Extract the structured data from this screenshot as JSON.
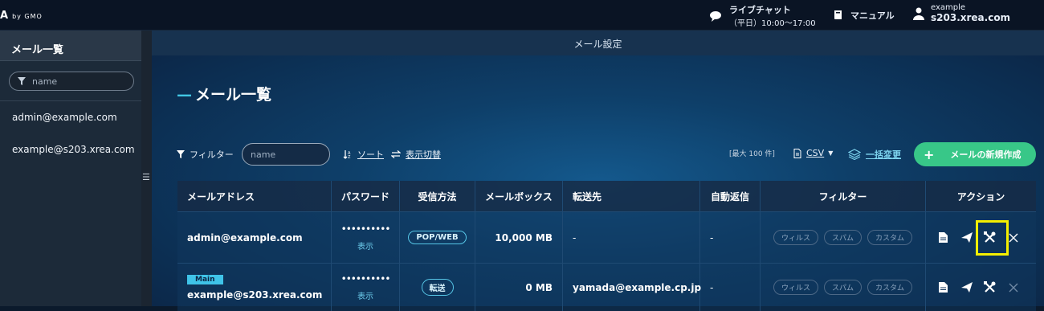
{
  "topbar": {
    "logo": "A",
    "logo_by": "by GMO",
    "chat_title": "ライブチャット",
    "chat_hours": "（平日）10:00〜17:00",
    "manual": "マニュアル",
    "account_user": "example",
    "account_host": "s203.xrea.com"
  },
  "sidebar": {
    "title": "メール一覧",
    "search_placeholder": "name",
    "items": [
      {
        "label": "admin@example.com"
      },
      {
        "label": "example@s203.xrea.com"
      }
    ]
  },
  "main": {
    "header": "メール設定",
    "title": "メール一覧",
    "toolbar": {
      "filter_label": "フィルター",
      "name_placeholder": "name",
      "sort_label": "ソート",
      "view_toggle_label": "表示切替",
      "max_count": "[最大 100 件]",
      "csv_label": "CSV",
      "bulk_change_label": "一括変更",
      "create_label": "メールの新規作成"
    },
    "table": {
      "headers": [
        "メールアドレス",
        "パスワード",
        "受信方法",
        "メールボックス",
        "転送先",
        "自動返信",
        "フィルター",
        "アクション"
      ],
      "rows": [
        {
          "badge": "",
          "address": "admin@example.com",
          "password": "••••••••••",
          "password_show": "表示",
          "method": "POP/WEB",
          "mailbox": "10,000 MB",
          "forward": "-",
          "autoreply": "-",
          "filters": [
            "ウィルス",
            "スパム",
            "カスタム"
          ]
        },
        {
          "badge": "Main",
          "address": "example@s203.xrea.com",
          "password": "••••••••••",
          "password_show": "表示",
          "method": "転送",
          "mailbox": "0 MB",
          "forward": "yamada@example.cp.jp",
          "autoreply": "-",
          "filters": [
            "ウィルス",
            "スパム",
            "カスタム"
          ]
        }
      ]
    }
  }
}
